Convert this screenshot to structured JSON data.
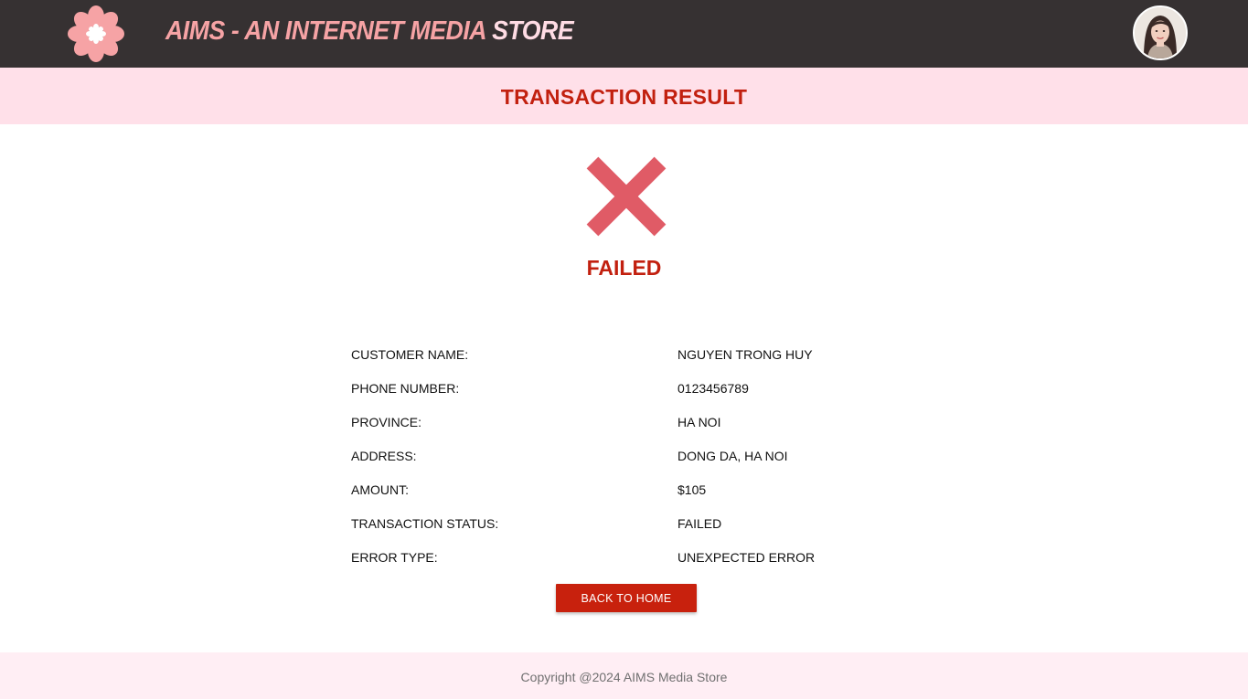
{
  "header": {
    "title_main": "AIMS - AN INTERNET MEDIA",
    "title_tail": " STORE",
    "logo_icon": "flower-logo-icon",
    "avatar_icon": "user-avatar"
  },
  "banner": {
    "title": "TRANSACTION RESULT"
  },
  "result": {
    "icon": "x-mark-icon",
    "status": "FAILED"
  },
  "details": [
    {
      "label": "CUSTOMER NAME:",
      "value": "NGUYEN TRONG HUY"
    },
    {
      "label": "PHONE NUMBER:",
      "value": "0123456789"
    },
    {
      "label": "PROVINCE:",
      "value": "HA NOI"
    },
    {
      "label": "ADDRESS:",
      "value": "DONG DA, HA NOI"
    },
    {
      "label": "AMOUNT:",
      "value": "$105"
    },
    {
      "label": "TRANSACTION STATUS:",
      "value": "FAILED"
    },
    {
      "label": "ERROR TYPE:",
      "value": "UNEXPECTED ERROR"
    }
  ],
  "actions": {
    "back_home_label": "BACK TO HOME"
  },
  "footer": {
    "copyright": "Copyright @2024 AIMS Media Store"
  },
  "colors": {
    "header_bg": "#363132",
    "banner_bg": "#ffe0e9",
    "accent_red": "#c2200f",
    "x_mark": "#e05b66",
    "logo_pink": "#f6a3a5",
    "footer_bg": "#ffeef4"
  }
}
